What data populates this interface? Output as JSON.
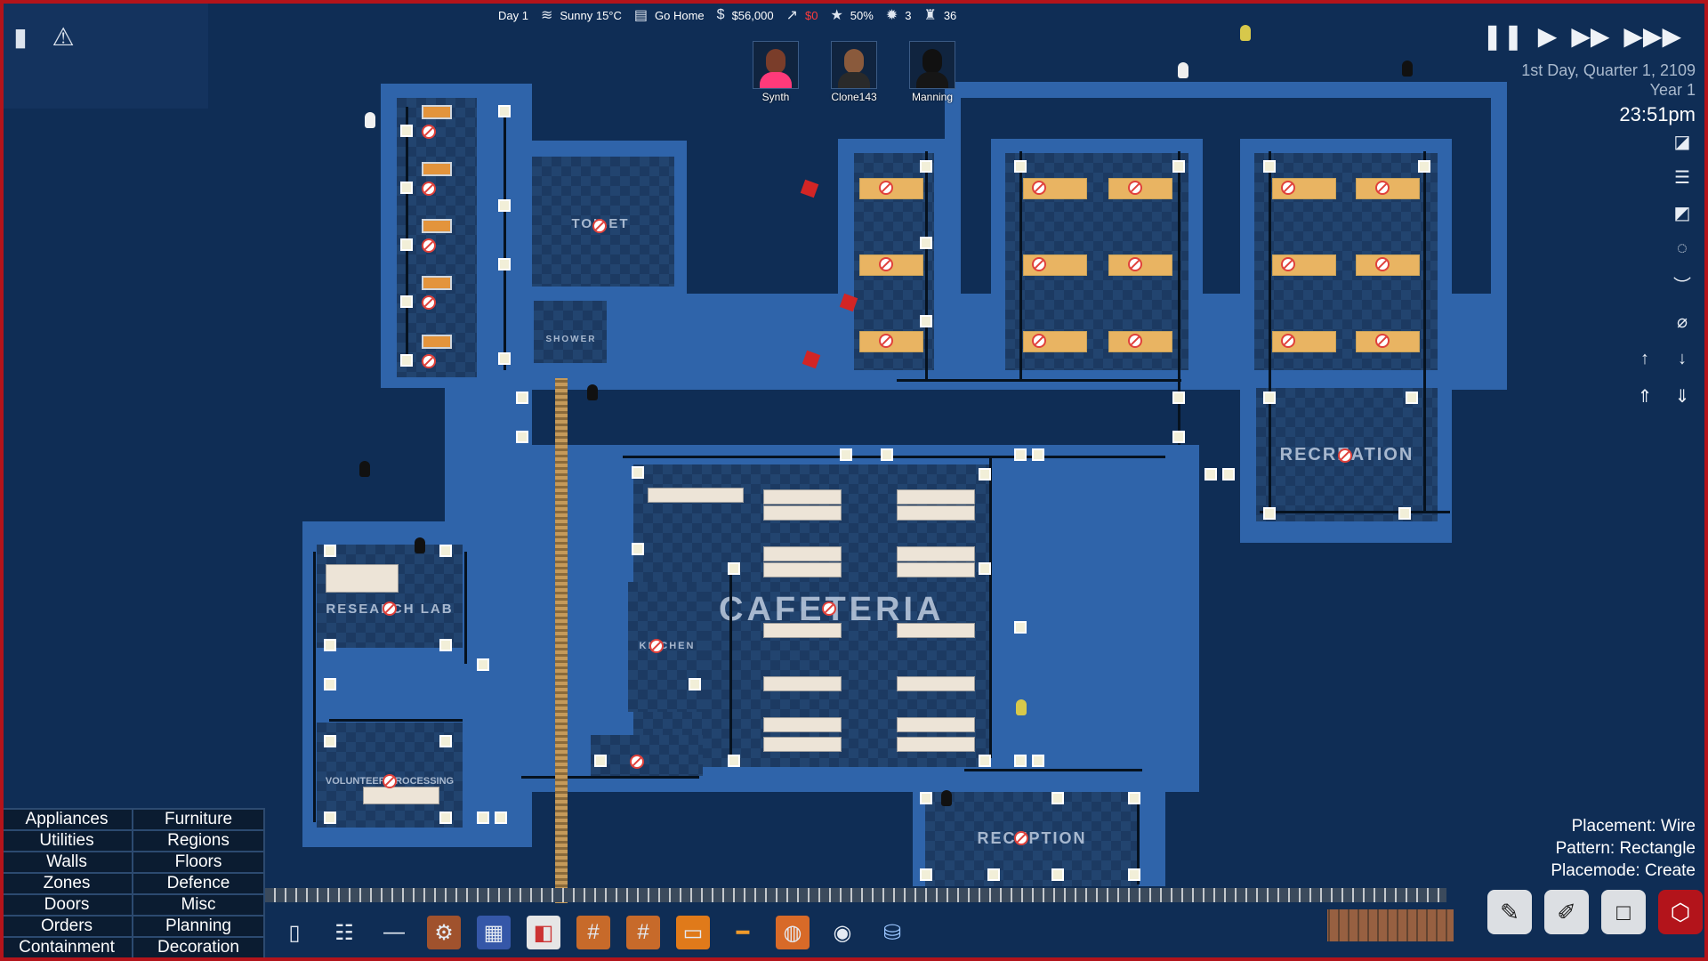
{
  "topbar": {
    "day": "Day 1",
    "weather": "Sunny 15°C",
    "shift": "Go Home",
    "money": "$56,000",
    "income": "$0",
    "rating": "50%",
    "threats": "3",
    "population": "36"
  },
  "staff": [
    {
      "name": "Synth",
      "skin": "#7a3d2a",
      "hair": "#1b0f0a",
      "shirt": "#ff3a7a"
    },
    {
      "name": "Clone143",
      "skin": "#8a5a3c",
      "hair": "#1a1a1a",
      "shirt": "#2a2a2a"
    },
    {
      "name": "Manning",
      "skin": "#e8e6e0",
      "hair": "#111111",
      "shirt": "#161616"
    }
  ],
  "time": {
    "date": "1st Day, Quarter 1, 2109",
    "year": "Year 1",
    "clock": "23:51pm"
  },
  "rooms": {
    "toilet": "TOILET",
    "shower": "SHOWER",
    "cafeteria": "CAFETERIA",
    "kitchen": "KITCHEN",
    "recreation": "RECREATION",
    "research_lab": "RESEARCH LAB",
    "volunteer_processing": "VOLUNTEER PROCESSING",
    "reception": "RECEPTION"
  },
  "build_menu": [
    "Appliances",
    "Furniture",
    "Utilities",
    "Regions",
    "Walls",
    "Floors",
    "Zones",
    "Defence",
    "Doors",
    "Misc",
    "Orders",
    "Planning",
    "Containment",
    "Decoration"
  ],
  "placement": {
    "placement": "Placement: Wire",
    "pattern": "Pattern: Rectangle",
    "placemode": "Placemode: Create"
  },
  "toolbar_icons": [
    "cabinet-icon",
    "shelf-icon",
    "wire-icon",
    "generator-icon",
    "solar-panel-icon",
    "water-tank-icon",
    "grate-icon",
    "vent-icon",
    "heater-icon",
    "pipe-icon",
    "fan-icon",
    "camera-icon",
    "water-cooler-icon"
  ],
  "colors": {
    "frame": "#b3141b",
    "wall": "#2f64aa",
    "floor": "#1c3a62"
  }
}
